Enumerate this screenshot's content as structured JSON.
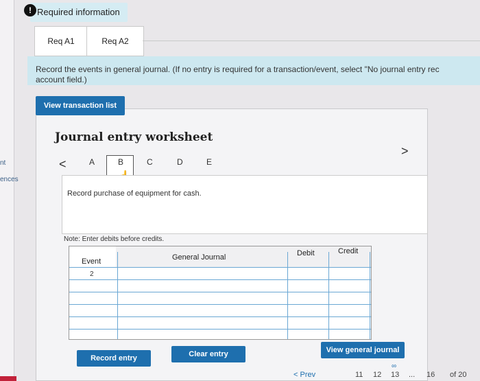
{
  "header": {
    "title": "Required information"
  },
  "tabs": [
    {
      "label": "Req A1"
    },
    {
      "label": "Req A2"
    }
  ],
  "instructions": {
    "line1": "Record the events in general journal. (If no entry is required for a transaction/event, select \"No journal entry rec",
    "line2": "account field.)"
  },
  "buttons": {
    "view_transaction_list": "View transaction list",
    "record_entry": "Record entry",
    "clear_entry": "Clear entry",
    "view_general_journal": "View general journal"
  },
  "worksheet": {
    "title": "Journal entry worksheet",
    "prev_arrow": "<",
    "next_arrow": ">",
    "letters": [
      "A",
      "B",
      "C",
      "D",
      "E"
    ],
    "selected_letter": "B",
    "description": "Record purchase of equipment for cash.",
    "note": "Note: Enter debits before credits."
  },
  "table": {
    "headers": {
      "event": "Event",
      "general_journal": "General Journal",
      "debit": "Debit",
      "credit": "Credit"
    },
    "event_value": "2"
  },
  "pagination": {
    "prev_label": "Prev",
    "pages": [
      "11",
      "12",
      "13",
      "...",
      "16"
    ],
    "current": "13",
    "of_label": "of 20"
  },
  "side_nav": {
    "item1": "nt",
    "item2": "ences"
  }
}
